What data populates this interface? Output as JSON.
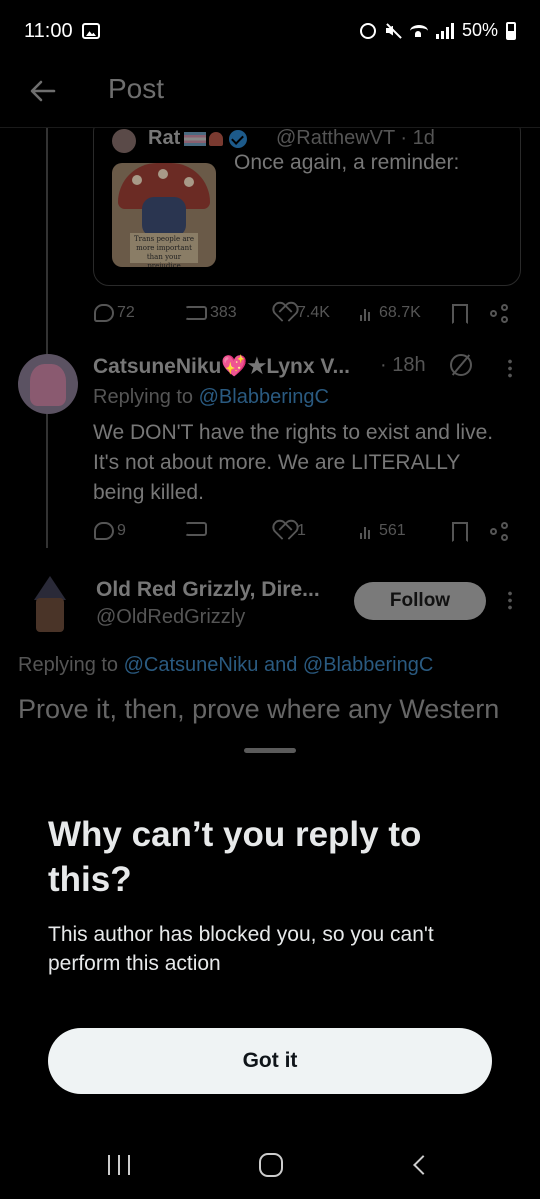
{
  "status_bar": {
    "time": "11:00",
    "battery": "50%"
  },
  "header": {
    "title": "Post"
  },
  "quoted_post": {
    "name": "Rat",
    "handle": "@RatthewVT · 1d",
    "text": "Once again, a reminder:",
    "image_sign_text": "Trans people are more important than your prejudice"
  },
  "post_actions": {
    "replies": "72",
    "reposts": "383",
    "likes": "7.4K",
    "views": "68.7K"
  },
  "reply": {
    "name": "CatsuneNiku💖★Lynx V...",
    "time": "· 18h",
    "replying_label": "Replying to",
    "replying_mention": "@BlabberingC",
    "body": "We DON'T have the rights to exist and live. It's not about more. We are LITERALLY being killed.",
    "replies": "9",
    "reposts": "",
    "likes": "1",
    "views": "561"
  },
  "main_post": {
    "name": "Old Red Grizzly, Dire...",
    "handle": "@OldRedGrizzly",
    "follow_label": "Follow",
    "replying_label": "Replying to",
    "replying_mentions": "@CatsuneNiku and @BlabberingC",
    "text": "Prove it, then, prove where any Western"
  },
  "sheet": {
    "title": "Why can’t you reply to this?",
    "body": "This author has blocked you, so you can't perform this action",
    "button_label": "Got it"
  },
  "colors": {
    "background": "#000000",
    "button_bg": "#eff3f4",
    "mention": "#1d9bf0"
  },
  "icons": [
    "back-arrow-icon",
    "reply-icon",
    "repost-icon",
    "like-icon",
    "views-icon",
    "bookmark-icon",
    "share-icon",
    "block-icon",
    "more-icon",
    "verified-icon"
  ]
}
